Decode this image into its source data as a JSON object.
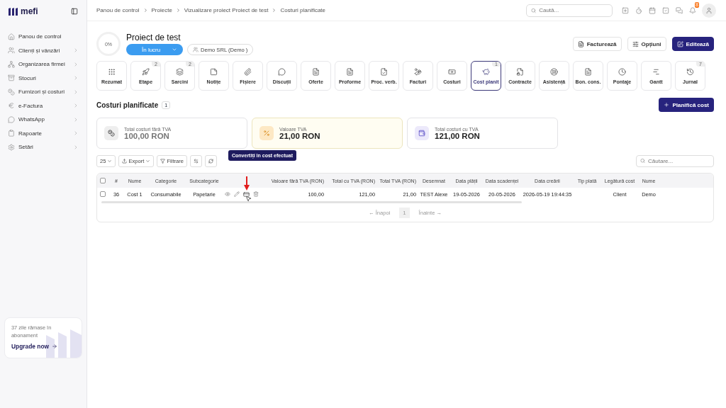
{
  "brand": {
    "name": "mefi"
  },
  "sidebar": {
    "items": [
      {
        "label": "Panou de control",
        "expandable": false
      },
      {
        "label": "Clienți și vânzări",
        "expandable": true
      },
      {
        "label": "Organizarea firmei",
        "expandable": true
      },
      {
        "label": "Stocuri",
        "expandable": true
      },
      {
        "label": "Furnizori și costuri",
        "expandable": true
      },
      {
        "label": "e-Factura",
        "expandable": true
      },
      {
        "label": "WhatsApp",
        "expandable": true
      },
      {
        "label": "Rapoarte",
        "expandable": true
      },
      {
        "label": "Setări",
        "expandable": true
      }
    ],
    "promo": {
      "text": "37 zile rămase în abonament",
      "link": "Upgrade now"
    }
  },
  "breadcrumb": [
    "Panou de control",
    "Proiecte",
    "Vizualizare proiect Proiect de test",
    "Costuri planificate"
  ],
  "search": {
    "placeholder": "Caută..."
  },
  "notifications": {
    "badge": "8"
  },
  "project": {
    "progress": "0%",
    "title": "Proiect de test",
    "status": "În lucru",
    "client": "Demo SRL (Demo )"
  },
  "actions": [
    "Facturează",
    "Opțiuni",
    "Editează"
  ],
  "tabs": [
    {
      "label": "Rezumat",
      "selected": false
    },
    {
      "label": "Etape",
      "badge": "2",
      "selected": false
    },
    {
      "label": "Sarcini",
      "badge": "2",
      "selected": false
    },
    {
      "label": "Notițe",
      "selected": false
    },
    {
      "label": "Fișiere",
      "selected": false
    },
    {
      "label": "Discuții",
      "selected": false
    },
    {
      "label": "Oferte",
      "selected": false
    },
    {
      "label": "Proforme",
      "selected": false
    },
    {
      "label": "Proc. verb.",
      "selected": false
    },
    {
      "label": "Facturi",
      "selected": false
    },
    {
      "label": "Costuri",
      "selected": false
    },
    {
      "label": "Cost planit",
      "badge": "1",
      "selected": true
    },
    {
      "label": "Contracte",
      "selected": false
    },
    {
      "label": "Asistență",
      "selected": false
    },
    {
      "label": "Bon. cons.",
      "selected": false
    },
    {
      "label": "Pontaje",
      "selected": false
    },
    {
      "label": "Gantt",
      "selected": false
    },
    {
      "label": "Jurnal",
      "badge": "7",
      "selected": false
    }
  ],
  "section": {
    "title": "Costuri planificate",
    "count": "1",
    "button": "Planifică cost"
  },
  "summary": [
    {
      "label": "Total costuri fără TVA",
      "value": "100,00 RON",
      "kind": "neutral"
    },
    {
      "label": "Valoare TVA",
      "value": "21,00 RON",
      "kind": "warning"
    },
    {
      "label": "Total costuri cu TVA",
      "value": "121,00 RON",
      "kind": "accent"
    }
  ],
  "toolbar": {
    "page_size": "25",
    "export": "Export",
    "filter": "Filtrare",
    "search_placeholder": "Căutare..."
  },
  "table": {
    "select_all": false,
    "columns": [
      "#",
      "Nume",
      "Categorie",
      "Subcategorie",
      "Valoare fără TVA (RON)",
      "Total cu TVA (RON)",
      "Total TVA (RON)",
      "Desemnat",
      "Data plății",
      "Data scadenței",
      "Data creării",
      "Tip plată",
      "Legătură cost",
      "Nume"
    ],
    "rows": [
      {
        "checked": false,
        "cells": [
          "36",
          "Cost 1",
          "Consumabile",
          "Papetarie",
          "100,00",
          "121,00",
          "21,00",
          "TEST Alexe",
          "19-05-2026",
          "20-05-2026",
          "2026-05-19 19:44:35",
          null,
          "Client",
          "Demo"
        ]
      }
    ]
  },
  "tooltip": "Convertiți în cost efectuat",
  "pagination": {
    "prev": "← Înapoi",
    "page": "1",
    "next": "Înainte →"
  }
}
